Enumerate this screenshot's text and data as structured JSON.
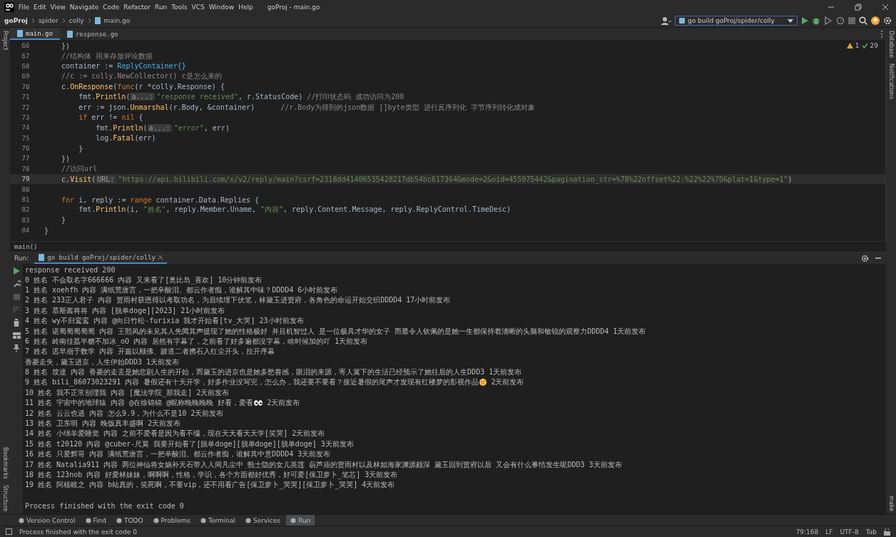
{
  "menu": [
    "File",
    "Edit",
    "View",
    "Navigate",
    "Code",
    "Refactor",
    "Run",
    "Tools",
    "VCS",
    "Window",
    "Help"
  ],
  "window": {
    "title": "goProj - main.go"
  },
  "breadcrumbs": [
    "goProj",
    "spider",
    "colly",
    "main.go"
  ],
  "run_config": "go build goProj/spider/colly",
  "tabs": [
    {
      "label": "main.go",
      "selected": true
    },
    {
      "label": "response.go",
      "selected": false
    }
  ],
  "left_tools_top": [
    "Project"
  ],
  "right_tools": [
    "Database",
    "Notifications"
  ],
  "inspections": {
    "warnings": "1",
    "ok": "29"
  },
  "code": [
    {
      "no": "66",
      "current": false,
      "tokens": [
        {
          "t": "    })",
          "kind": "plain"
        }
      ]
    },
    {
      "no": "67",
      "current": false,
      "tokens": [
        {
          "t": "    //结构体 用来存放评论数据",
          "kind": "comment"
        }
      ]
    },
    {
      "no": "68",
      "current": false,
      "tokens": [
        {
          "t": "    container := ",
          "kind": "plain"
        },
        {
          "t": "ReplyContainer{}",
          "kind": "type"
        }
      ]
    },
    {
      "no": "69",
      "current": false,
      "tokens": [
        {
          "t": "    //c := colly.NewCollector() c是怎么来的",
          "kind": "comment"
        }
      ]
    },
    {
      "no": "70",
      "current": false,
      "tokens": [
        {
          "t": "    c.",
          "kind": "plain"
        },
        {
          "t": "OnResponse",
          "kind": "function"
        },
        {
          "t": "(",
          "kind": "plain"
        },
        {
          "t": "func",
          "kind": "keyword"
        },
        {
          "t": "(r *colly.Response) {",
          "kind": "plain"
        }
      ]
    },
    {
      "no": "71",
      "current": false,
      "tokens": [
        {
          "t": "        fmt.",
          "kind": "plain"
        },
        {
          "t": "Println",
          "kind": "function"
        },
        {
          "t": "(",
          "kind": "plain"
        },
        {
          "t": "a...:",
          "kind": "hint"
        },
        {
          "t": "\"response received\"",
          "kind": "string"
        },
        {
          "t": ", r.StatusCode) ",
          "kind": "plain"
        },
        {
          "t": "//打印状态码 成功访问为200",
          "kind": "comment"
        }
      ]
    },
    {
      "no": "72",
      "current": false,
      "tokens": [
        {
          "t": "        err := json.",
          "kind": "plain"
        },
        {
          "t": "Unmarshal",
          "kind": "function"
        },
        {
          "t": "(r.Body, &container)      ",
          "kind": "plain"
        },
        {
          "t": "//r.Body为得到的json数据 []byte类型 进行反序列化 字节序列转化成对象",
          "kind": "comment"
        }
      ]
    },
    {
      "no": "73",
      "current": false,
      "tokens": [
        {
          "t": "        if",
          "kind": "keyword"
        },
        {
          "t": " err != ",
          "kind": "plain"
        },
        {
          "t": "nil",
          "kind": "keyword"
        },
        {
          "t": " {",
          "kind": "plain"
        }
      ]
    },
    {
      "no": "74",
      "current": false,
      "tokens": [
        {
          "t": "            fmt.",
          "kind": "plain"
        },
        {
          "t": "Println",
          "kind": "function"
        },
        {
          "t": "(",
          "kind": "plain"
        },
        {
          "t": "a...:",
          "kind": "hint"
        },
        {
          "t": "\"error\"",
          "kind": "string"
        },
        {
          "t": ", err)",
          "kind": "plain"
        }
      ]
    },
    {
      "no": "75",
      "current": false,
      "tokens": [
        {
          "t": "            log.",
          "kind": "plain"
        },
        {
          "t": "Fatal",
          "kind": "function"
        },
        {
          "t": "(err)",
          "kind": "plain"
        }
      ]
    },
    {
      "no": "76",
      "current": false,
      "tokens": [
        {
          "t": "        }",
          "kind": "plain"
        }
      ]
    },
    {
      "no": "77",
      "current": false,
      "tokens": [
        {
          "t": "    })",
          "kind": "plain"
        }
      ]
    },
    {
      "no": "78",
      "current": false,
      "tokens": [
        {
          "t": "    //访问url",
          "kind": "comment"
        }
      ]
    },
    {
      "no": "79",
      "current": true,
      "tokens": [
        {
          "t": "    c.",
          "kind": "plain"
        },
        {
          "t": "Visit",
          "kind": "function"
        },
        {
          "t": "(",
          "kind": "plain"
        },
        {
          "t": "URL:",
          "kind": "hint"
        },
        {
          "t": "\"https://api.bilibili.com/x/v2/reply/main?csrf=2318dd41406535428217db54bc617364&mode=2&oid=455975442&pagination_str=%7B%22offset%22:%22%22%7D&plat=1&type=1\"",
          "kind": "string"
        },
        {
          "t": ")",
          "kind": "plain"
        }
      ]
    },
    {
      "no": "80",
      "current": false
    },
    {
      "no": "81",
      "current": false,
      "tokens": [
        {
          "t": "    for",
          "kind": "keyword"
        },
        {
          "t": " i, reply := ",
          "kind": "plain"
        },
        {
          "t": "range",
          "kind": "keyword"
        },
        {
          "t": " container.Data.Replies {",
          "kind": "plain"
        }
      ]
    },
    {
      "no": "82",
      "current": false,
      "tokens": [
        {
          "t": "        fmt.",
          "kind": "plain"
        },
        {
          "t": "Println",
          "kind": "function"
        },
        {
          "t": "(i, ",
          "kind": "plain"
        },
        {
          "t": "\"姓名\"",
          "kind": "string"
        },
        {
          "t": ", reply.Member.Uname, ",
          "kind": "plain"
        },
        {
          "t": "\"内容\"",
          "kind": "string"
        },
        {
          "t": ", reply.Content.Message, reply.ReplyControl.TimeDesc)",
          "kind": "plain"
        }
      ]
    },
    {
      "no": "83",
      "current": false,
      "tokens": [
        {
          "t": "    }",
          "kind": "plain"
        }
      ]
    },
    {
      "no": "84",
      "current": false,
      "tokens": [
        {
          "t": "}",
          "kind": "plain"
        }
      ]
    }
  ],
  "editor_breadcrumb": "main()",
  "run_panel": {
    "label": "Run:",
    "tab": "go build goProj/spider/colly"
  },
  "output": [
    {
      "text": "response received 200"
    },
    {
      "text": "0 姓名 不会取名字666666 内容 又来看了[奥比岛_喜欢] 10分钟前发布"
    },
    {
      "text": "1 姓名 xoehfh 内容 满纸荒唐言，一把辛酸泪。都云作者痴，谁解其中味？DDDD4 6小时前发布"
    },
    {
      "text": "2 姓名 233正人君子 内容 贾雨村获恩得以考取功名，为后续埋下伏笔，林黛玉进贾府，各角色的命运开始交织DDDD4 17小时前发布"
    },
    {
      "text": "3 姓名 慕斯酱将将 内容 [脱单doge][2023] 21小时前发布"
    },
    {
      "text": "4 姓名 wy不归鸾鸾 内容 @向日竹松-furixia 我才开始看[tv_大哭] 23小时前发布"
    },
    {
      "text": "5 姓名 诺蜀蜀蜀蜀蜀 内容 王熙凤的未见其人先闻其声提现了她的性格极好 并且机智过人 是一位极具才华的女子 而最令人钦佩的是她一生都保持着清晰的头脑和敏锐的观察力DDDD4 1天前发布"
    },
    {
      "text": "6 姓名 岭南佳荔半糖不加冰_oO 内容 居然有字幕了，之前看了好多遍都没字幕，啥时候加的吖 1天前发布"
    },
    {
      "text": "7 姓名 迟早崩于数学 内容 开篇以颠佛、跛道二者携石入红尘开头，拉开序幕"
    },
    {
      "text": "香菱走失，黛玉进京，人生伊始DDD3 1天前发布"
    },
    {
      "text": "8 姓名 坟達 内容 香菱的走丢是她悲剧人生的开始，而黛玉的进京也是她多愁善感，眼泪的来源，寄人篱下的生活已经预示了她往后的人生DDD3 1天前发布"
    },
    {
      "text": "9 姓名 bili_86073023291 内容 暑假还有十天开学，好多作业没写完，怎么办，我还要不要看？接近暑假的尾声才发现有红楼梦的影视作品",
      "kind": "face",
      "tail": " 2天前发布"
    },
    {
      "text": "10 姓名 我不正常别理我 内容 [魔法学院_那我走] 2天前发布"
    },
    {
      "text": "11 姓名 宇宙中的地球猿 内容 @在徐锦锦 @昵称晚晚晚晚 好看，爱看",
      "kind": "eyes",
      "tail": " 2天前发布"
    },
    {
      "text": "12 姓名 云云也逍 内容 怎么9.9，为什么不是10 2天前发布"
    },
    {
      "text": "13 姓名 卫东明 内容 晚饭真丰盛啊 2天前发布"
    },
    {
      "text": "14 姓名 小绵羊爱睡觉 内容 之前不爱看是因为看不懂，现在天天看天天学[笑哭] 2天前发布"
    },
    {
      "text": "15 姓名 t20120 内容 @cuber-尺莫 我要开始看了[脱单doge][脱单doge][脱单doge] 3天前发布"
    },
    {
      "text": "16 姓名 只爱辉哥 内容 满纸荒唐言，一把辛酸泪。都云作者痴，谁解其中意DDDD4 3天前发布"
    },
    {
      "text": "17 姓名 Natalia911 内容 两位神仙将女娲补天石带入人间凡尘中 甄士隐的女儿英莲 葫芦庙的贾雨村以及林如海家渊源颇深 黛玉回到贾府以后 又会有什么事情发生呢DDD3 3天前发布"
    },
    {
      "text": "18 姓名 123nob 内容 好爱林妹妹，啊啊啊，性格，学识，各个方面都好优秀，好可爱[保卫萝卜_笔芯] 3天前发布"
    },
    {
      "text": "19 姓名 阿核岐之 内容 b站真的，笑死啊，不要vip，还不用看广告[保卫萝卜_哭哭][保卫萝卜_哭哭] 4天前发布"
    },
    {
      "text": "Process finished with the exit code 0",
      "gap": true
    }
  ],
  "left_tools_bottom": [
    "Bookmarks",
    "Structure"
  ],
  "right_tools_bottom": [
    "make"
  ],
  "tool_windows": [
    {
      "label": "Version Control",
      "selected": false
    },
    {
      "label": "Find",
      "selected": false
    },
    {
      "label": "TODO",
      "selected": false
    },
    {
      "label": "Problems",
      "selected": false
    },
    {
      "label": "Terminal",
      "selected": false
    },
    {
      "label": "Services",
      "selected": false
    },
    {
      "label": "Run",
      "selected": true
    }
  ],
  "status_bar": {
    "message": "Process finished with the exit code 0",
    "position": "79:168",
    "line_sep": "LF",
    "encoding": "UTF-8",
    "indent": "Tab"
  }
}
